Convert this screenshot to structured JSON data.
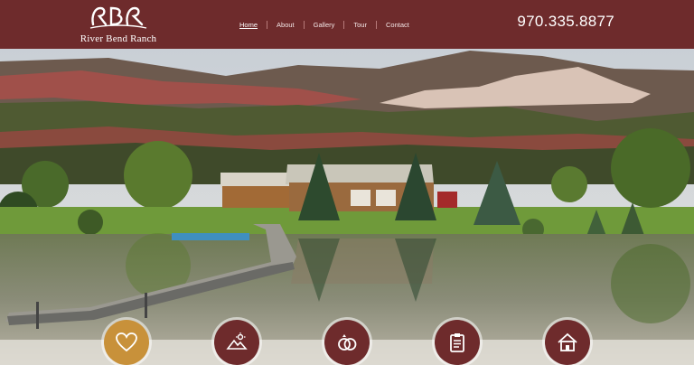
{
  "brand": {
    "name": "River Bend Ranch",
    "mark": "RBR-logo-icon"
  },
  "nav": {
    "items": [
      {
        "label": "Home",
        "active": true
      },
      {
        "label": "About",
        "active": false
      },
      {
        "label": "Gallery",
        "active": false
      },
      {
        "label": "Tour",
        "active": false
      },
      {
        "label": "Contact",
        "active": false
      }
    ]
  },
  "phone": "970.335.8877",
  "hero": {
    "image": "ranch-lodge-pond-mountains-photo"
  },
  "feature_icons": [
    {
      "icon": "heart-icon",
      "color": "#c8913a"
    },
    {
      "icon": "mountain-sun-icon",
      "color": "#6e2b2c"
    },
    {
      "icon": "wedding-rings-icon",
      "color": "#6e2b2c"
    },
    {
      "icon": "clipboard-icon",
      "color": "#6e2b2c"
    },
    {
      "icon": "house-icon",
      "color": "#6e2b2c"
    }
  ],
  "colors": {
    "header_bg": "#6e2b2c",
    "accent_gold": "#c8913a",
    "text_light": "#ffffff"
  }
}
